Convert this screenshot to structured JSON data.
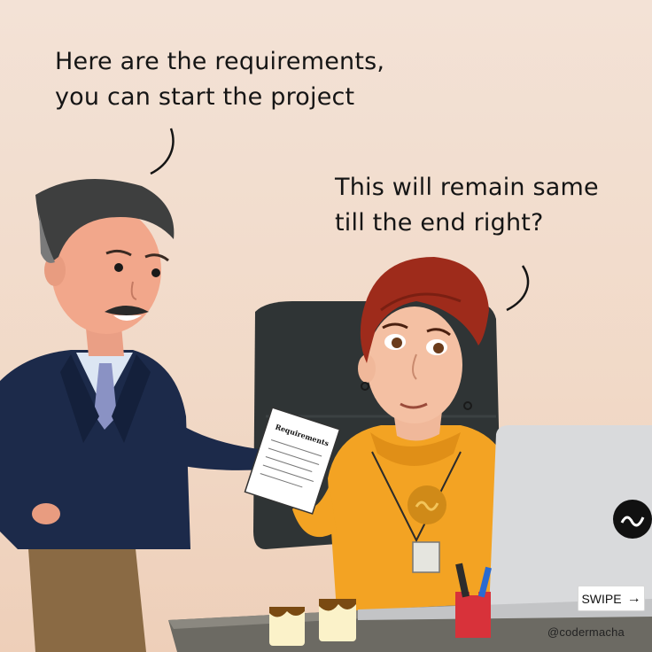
{
  "speech": {
    "manager_line1": "Here are the requirements,",
    "manager_line2": "you can start the project",
    "developer_line1": "This will remain same",
    "developer_line2": "till the end right?"
  },
  "document": {
    "title": "Requirements"
  },
  "nav": {
    "swipe_label": "SWIPE",
    "swipe_arrow": "→"
  },
  "footer": {
    "handle": "@codermacha"
  },
  "colors": {
    "background": "#f1dacb",
    "hoodie": "#f3a323",
    "suit": "#1c2a4a",
    "chair": "#2f3435",
    "laptop": "#d9dadc"
  }
}
